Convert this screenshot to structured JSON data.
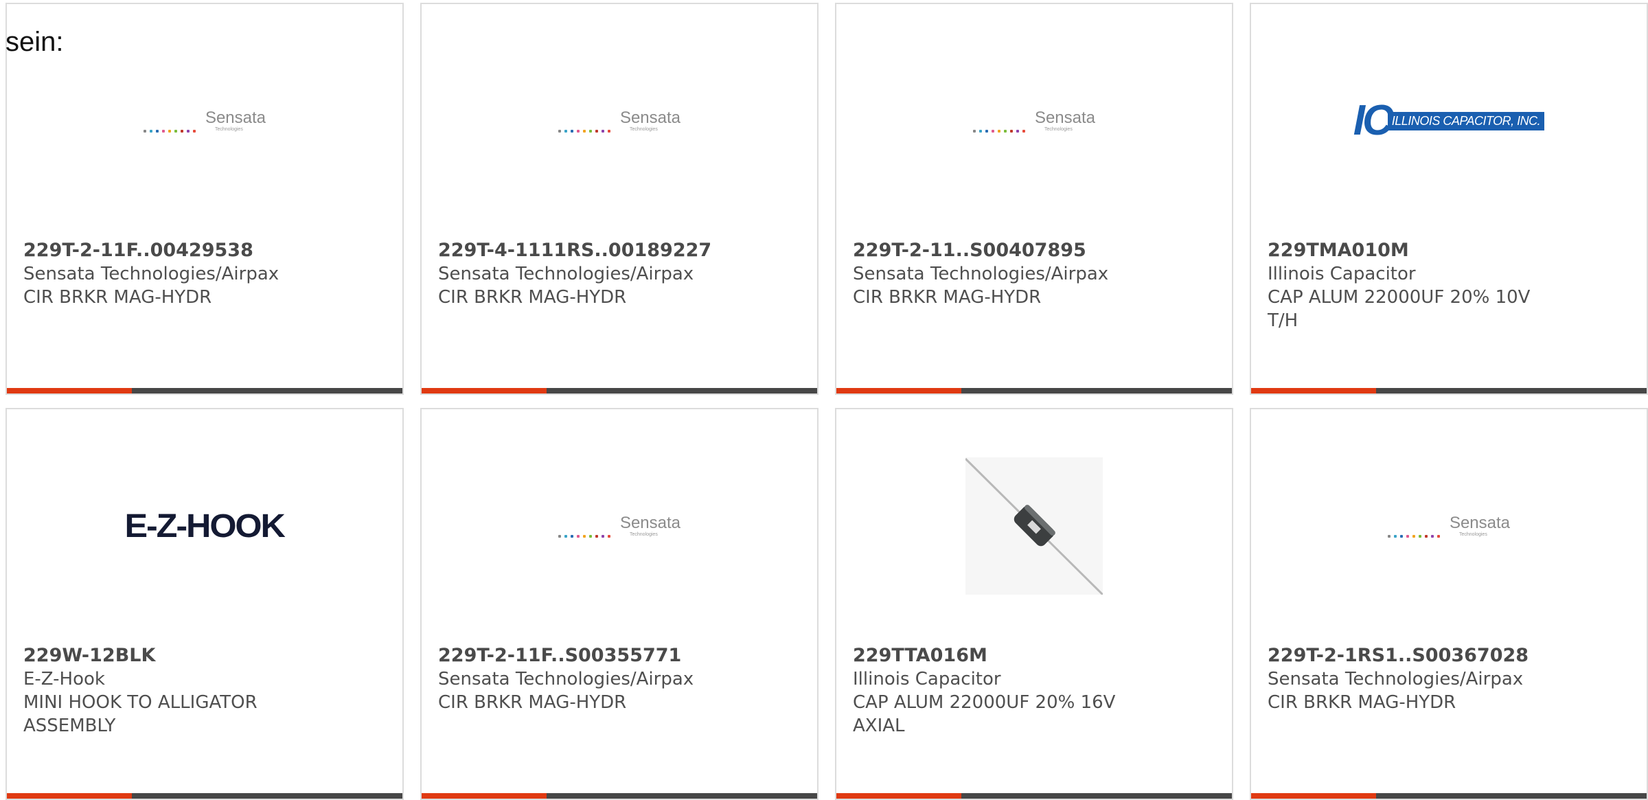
{
  "intro_text": "sein:",
  "colors": {
    "accent": "#e03a12",
    "bar": "#474747",
    "border": "#dcdcdc",
    "text": "#4f4f4f"
  },
  "products": [
    {
      "part_number": "229T-2-11F..00429538",
      "manufacturer": "Sensata Technologies/Airpax",
      "description": "CIR BRKR MAG-HYDR",
      "image": "sensata-logo"
    },
    {
      "part_number": "229T-4-1111RS..00189227",
      "manufacturer": "Sensata Technologies/Airpax",
      "description": "CIR BRKR MAG-HYDR",
      "image": "sensata-logo"
    },
    {
      "part_number": "229T-2-11..S00407895",
      "manufacturer": "Sensata Technologies/Airpax",
      "description": "CIR BRKR MAG-HYDR",
      "image": "sensata-logo"
    },
    {
      "part_number": "229TMA010M",
      "manufacturer": "Illinois Capacitor",
      "description": "CAP ALUM 22000UF 20% 10V T/H",
      "image": "illinois-capacitor-logo"
    },
    {
      "part_number": "229W-12BLK",
      "manufacturer": "E-Z-Hook",
      "description": "MINI HOOK TO ALLIGATOR ASSEMBLY",
      "image": "ez-hook-logo"
    },
    {
      "part_number": "229T-2-11F..S00355771",
      "manufacturer": "Sensata Technologies/Airpax",
      "description": "CIR BRKR MAG-HYDR",
      "image": "sensata-logo"
    },
    {
      "part_number": "229TTA016M",
      "manufacturer": "Illinois Capacitor",
      "description": "CAP ALUM 22000UF 20% 16V AXIAL",
      "image": "axial-capacitor-photo"
    },
    {
      "part_number": "229T-2-1RS1..S00367028",
      "manufacturer": "Sensata Technologies/Airpax",
      "description": "CIR BRKR MAG-HYDR",
      "image": "sensata-logo"
    }
  ],
  "logos": {
    "sensata_name": "Sensata",
    "sensata_tagline": "Technologies",
    "ezhook_text": "E-Z-HOOK",
    "illinois_mark": "IC",
    "illinois_banner": "ILLINOIS CAPACITOR, INC."
  }
}
